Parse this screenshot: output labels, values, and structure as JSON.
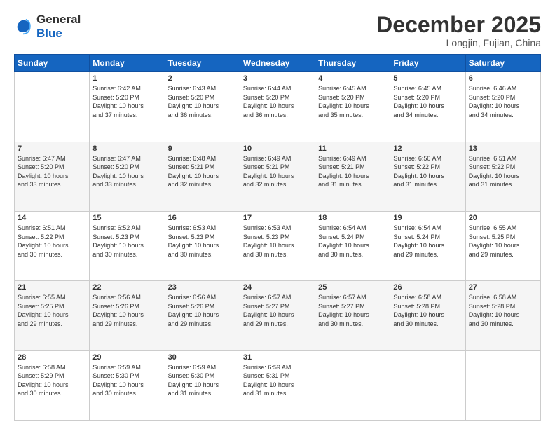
{
  "logo": {
    "line1": "General",
    "line2": "Blue"
  },
  "title": "December 2025",
  "subtitle": "Longjin, Fujian, China",
  "weekdays": [
    "Sunday",
    "Monday",
    "Tuesday",
    "Wednesday",
    "Thursday",
    "Friday",
    "Saturday"
  ],
  "weeks": [
    [
      {
        "day": "",
        "info": ""
      },
      {
        "day": "1",
        "info": "Sunrise: 6:42 AM\nSunset: 5:20 PM\nDaylight: 10 hours\nand 37 minutes."
      },
      {
        "day": "2",
        "info": "Sunrise: 6:43 AM\nSunset: 5:20 PM\nDaylight: 10 hours\nand 36 minutes."
      },
      {
        "day": "3",
        "info": "Sunrise: 6:44 AM\nSunset: 5:20 PM\nDaylight: 10 hours\nand 36 minutes."
      },
      {
        "day": "4",
        "info": "Sunrise: 6:45 AM\nSunset: 5:20 PM\nDaylight: 10 hours\nand 35 minutes."
      },
      {
        "day": "5",
        "info": "Sunrise: 6:45 AM\nSunset: 5:20 PM\nDaylight: 10 hours\nand 34 minutes."
      },
      {
        "day": "6",
        "info": "Sunrise: 6:46 AM\nSunset: 5:20 PM\nDaylight: 10 hours\nand 34 minutes."
      }
    ],
    [
      {
        "day": "7",
        "info": "Sunrise: 6:47 AM\nSunset: 5:20 PM\nDaylight: 10 hours\nand 33 minutes."
      },
      {
        "day": "8",
        "info": "Sunrise: 6:47 AM\nSunset: 5:20 PM\nDaylight: 10 hours\nand 33 minutes."
      },
      {
        "day": "9",
        "info": "Sunrise: 6:48 AM\nSunset: 5:21 PM\nDaylight: 10 hours\nand 32 minutes."
      },
      {
        "day": "10",
        "info": "Sunrise: 6:49 AM\nSunset: 5:21 PM\nDaylight: 10 hours\nand 32 minutes."
      },
      {
        "day": "11",
        "info": "Sunrise: 6:49 AM\nSunset: 5:21 PM\nDaylight: 10 hours\nand 31 minutes."
      },
      {
        "day": "12",
        "info": "Sunrise: 6:50 AM\nSunset: 5:22 PM\nDaylight: 10 hours\nand 31 minutes."
      },
      {
        "day": "13",
        "info": "Sunrise: 6:51 AM\nSunset: 5:22 PM\nDaylight: 10 hours\nand 31 minutes."
      }
    ],
    [
      {
        "day": "14",
        "info": "Sunrise: 6:51 AM\nSunset: 5:22 PM\nDaylight: 10 hours\nand 30 minutes."
      },
      {
        "day": "15",
        "info": "Sunrise: 6:52 AM\nSunset: 5:23 PM\nDaylight: 10 hours\nand 30 minutes."
      },
      {
        "day": "16",
        "info": "Sunrise: 6:53 AM\nSunset: 5:23 PM\nDaylight: 10 hours\nand 30 minutes."
      },
      {
        "day": "17",
        "info": "Sunrise: 6:53 AM\nSunset: 5:23 PM\nDaylight: 10 hours\nand 30 minutes."
      },
      {
        "day": "18",
        "info": "Sunrise: 6:54 AM\nSunset: 5:24 PM\nDaylight: 10 hours\nand 30 minutes."
      },
      {
        "day": "19",
        "info": "Sunrise: 6:54 AM\nSunset: 5:24 PM\nDaylight: 10 hours\nand 29 minutes."
      },
      {
        "day": "20",
        "info": "Sunrise: 6:55 AM\nSunset: 5:25 PM\nDaylight: 10 hours\nand 29 minutes."
      }
    ],
    [
      {
        "day": "21",
        "info": "Sunrise: 6:55 AM\nSunset: 5:25 PM\nDaylight: 10 hours\nand 29 minutes."
      },
      {
        "day": "22",
        "info": "Sunrise: 6:56 AM\nSunset: 5:26 PM\nDaylight: 10 hours\nand 29 minutes."
      },
      {
        "day": "23",
        "info": "Sunrise: 6:56 AM\nSunset: 5:26 PM\nDaylight: 10 hours\nand 29 minutes."
      },
      {
        "day": "24",
        "info": "Sunrise: 6:57 AM\nSunset: 5:27 PM\nDaylight: 10 hours\nand 29 minutes."
      },
      {
        "day": "25",
        "info": "Sunrise: 6:57 AM\nSunset: 5:27 PM\nDaylight: 10 hours\nand 30 minutes."
      },
      {
        "day": "26",
        "info": "Sunrise: 6:58 AM\nSunset: 5:28 PM\nDaylight: 10 hours\nand 30 minutes."
      },
      {
        "day": "27",
        "info": "Sunrise: 6:58 AM\nSunset: 5:28 PM\nDaylight: 10 hours\nand 30 minutes."
      }
    ],
    [
      {
        "day": "28",
        "info": "Sunrise: 6:58 AM\nSunset: 5:29 PM\nDaylight: 10 hours\nand 30 minutes."
      },
      {
        "day": "29",
        "info": "Sunrise: 6:59 AM\nSunset: 5:30 PM\nDaylight: 10 hours\nand 30 minutes."
      },
      {
        "day": "30",
        "info": "Sunrise: 6:59 AM\nSunset: 5:30 PM\nDaylight: 10 hours\nand 31 minutes."
      },
      {
        "day": "31",
        "info": "Sunrise: 6:59 AM\nSunset: 5:31 PM\nDaylight: 10 hours\nand 31 minutes."
      },
      {
        "day": "",
        "info": ""
      },
      {
        "day": "",
        "info": ""
      },
      {
        "day": "",
        "info": ""
      }
    ]
  ]
}
